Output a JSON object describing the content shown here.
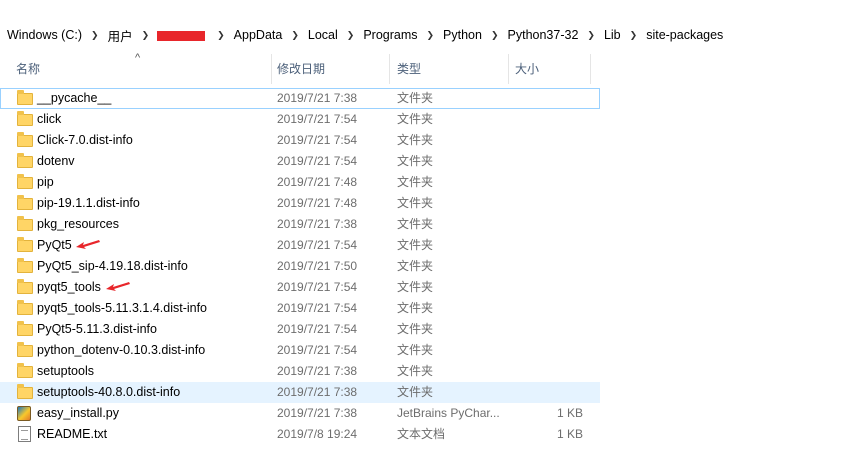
{
  "address": {
    "crumbs": [
      "Windows (C:)",
      "用户",
      "",
      "AppData",
      "Local",
      "Programs",
      "Python",
      "Python37-32",
      "Lib",
      "site-packages"
    ]
  },
  "columns": {
    "name": "名称",
    "date": "修改日期",
    "type": "类型",
    "size": "大小"
  },
  "files": [
    {
      "name": "__pycache__",
      "date": "2019/7/21 7:38",
      "type": "文件夹",
      "size": "",
      "icon": "folder-icon"
    },
    {
      "name": "click",
      "date": "2019/7/21 7:54",
      "type": "文件夹",
      "size": "",
      "icon": "folder-icon"
    },
    {
      "name": "Click-7.0.dist-info",
      "date": "2019/7/21 7:54",
      "type": "文件夹",
      "size": "",
      "icon": "folder-icon"
    },
    {
      "name": "dotenv",
      "date": "2019/7/21 7:54",
      "type": "文件夹",
      "size": "",
      "icon": "folder-icon"
    },
    {
      "name": "pip",
      "date": "2019/7/21 7:48",
      "type": "文件夹",
      "size": "",
      "icon": "folder-icon"
    },
    {
      "name": "pip-19.1.1.dist-info",
      "date": "2019/7/21 7:48",
      "type": "文件夹",
      "size": "",
      "icon": "folder-icon"
    },
    {
      "name": "pkg_resources",
      "date": "2019/7/21 7:38",
      "type": "文件夹",
      "size": "",
      "icon": "folder-icon"
    },
    {
      "name": "PyQt5",
      "date": "2019/7/21 7:54",
      "type": "文件夹",
      "size": "",
      "icon": "folder-icon"
    },
    {
      "name": "PyQt5_sip-4.19.18.dist-info",
      "date": "2019/7/21 7:50",
      "type": "文件夹",
      "size": "",
      "icon": "folder-icon"
    },
    {
      "name": "pyqt5_tools",
      "date": "2019/7/21 7:54",
      "type": "文件夹",
      "size": "",
      "icon": "folder-icon"
    },
    {
      "name": "pyqt5_tools-5.11.3.1.4.dist-info",
      "date": "2019/7/21 7:54",
      "type": "文件夹",
      "size": "",
      "icon": "folder-icon"
    },
    {
      "name": "PyQt5-5.11.3.dist-info",
      "date": "2019/7/21 7:54",
      "type": "文件夹",
      "size": "",
      "icon": "folder-icon"
    },
    {
      "name": "python_dotenv-0.10.3.dist-info",
      "date": "2019/7/21 7:54",
      "type": "文件夹",
      "size": "",
      "icon": "folder-icon"
    },
    {
      "name": "setuptools",
      "date": "2019/7/21 7:38",
      "type": "文件夹",
      "size": "",
      "icon": "folder-icon"
    },
    {
      "name": "setuptools-40.8.0.dist-info",
      "date": "2019/7/21 7:38",
      "type": "文件夹",
      "size": "",
      "icon": "folder-icon"
    },
    {
      "name": "easy_install.py",
      "date": "2019/7/21 7:38",
      "type": "JetBrains PyChar...",
      "size": "1 KB",
      "icon": "python-file-icon"
    },
    {
      "name": "README.txt",
      "date": "2019/7/8 19:24",
      "type": "文本文档",
      "size": "1 KB",
      "icon": "text-file-icon"
    }
  ],
  "colors": {
    "selection": "#e5f3ff",
    "focus_border": "#99d1ff",
    "annotation_arrow": "#e8262b",
    "header_text": "#4c607a"
  }
}
